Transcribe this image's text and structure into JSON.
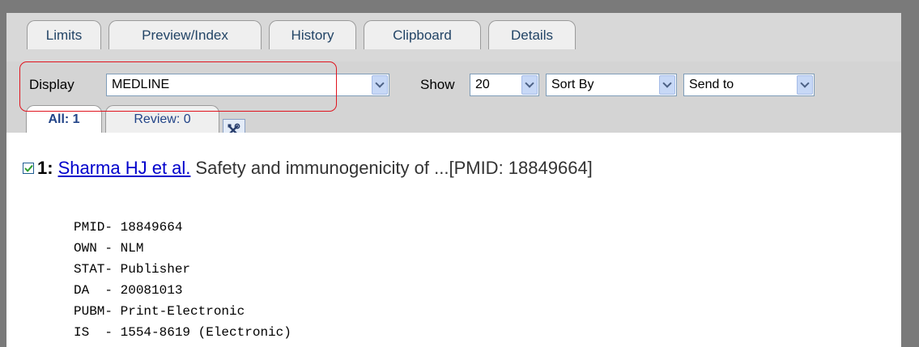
{
  "tabs": [
    {
      "label": "Limits"
    },
    {
      "label": "Preview/Index"
    },
    {
      "label": "History"
    },
    {
      "label": "Clipboard"
    },
    {
      "label": "Details"
    }
  ],
  "toolbar": {
    "display_label": "Display",
    "display_value": "MEDLINE",
    "show_label": "Show",
    "show_value": "20",
    "sort_value": "Sort By",
    "send_value": "Send to"
  },
  "subtabs": {
    "all": "All: 1",
    "review": "Review: 0"
  },
  "icons": {
    "tools": "tools-icon",
    "checkbox": "checkbox-checked-icon",
    "dropdown": "chevron-down-icon"
  },
  "colors": {
    "highlight": "#e0141e",
    "link": "#0000cc",
    "checkmark": "#2e9e2e"
  },
  "result": {
    "index": "1:",
    "authors": "Sharma HJ et al.",
    "title_snippet": "Safety and immunogenicity of ...[PMID: 18849664]"
  },
  "medline_lines": [
    "PMID- 18849664",
    "OWN - NLM",
    "STAT- Publisher",
    "DA  - 20081013",
    "PUBM- Print-Electronic",
    "IS  - 1554-8619 (Electronic)"
  ]
}
